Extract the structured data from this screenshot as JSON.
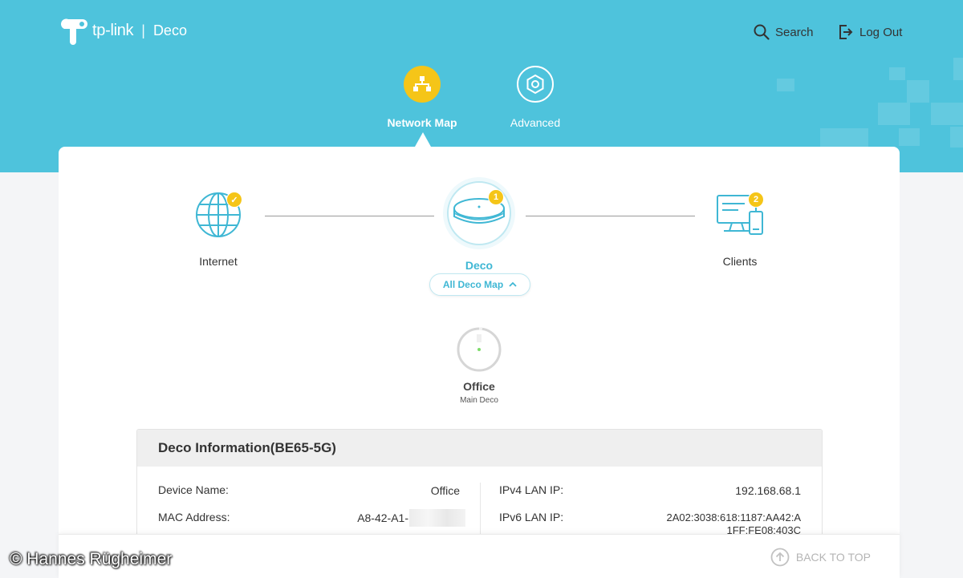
{
  "header": {
    "brand": "tp-link",
    "product": "Deco",
    "search_label": "Search",
    "logout_label": "Log Out",
    "tabs": [
      {
        "label": "Network Map",
        "icon": "network-map-icon",
        "active": true
      },
      {
        "label": "Advanced",
        "icon": "gear-icon",
        "active": false
      }
    ]
  },
  "topology": {
    "internet": {
      "label": "Internet",
      "status": "connected"
    },
    "deco": {
      "label": "Deco",
      "count": "1"
    },
    "clients": {
      "label": "Clients",
      "count": "2"
    },
    "toggle_label": "All Deco Map",
    "office": {
      "name": "Office",
      "role": "Main Deco"
    }
  },
  "deco_info": {
    "title": "Deco Information(BE65-5G)",
    "rows": [
      {
        "label": "Device Name:",
        "value": "Office"
      },
      {
        "label": "MAC Address:",
        "value": "A8-42-A1-"
      },
      {
        "label": "IPv4 LAN IP:",
        "value": "192.168.68.1"
      },
      {
        "label": "IPv6 LAN IP:",
        "value": "2A02:3038:618:1187:AA42:A\n1FF:FE08:403C"
      }
    ]
  },
  "footer": {
    "back_to_top": "BACK TO TOP"
  },
  "watermark": "© Hannes Rügheimer",
  "colors": {
    "header_bg": "#4ec3dc",
    "accent": "#3fb7d4",
    "badge": "#f5c518",
    "active_tab": "#f5c518"
  }
}
